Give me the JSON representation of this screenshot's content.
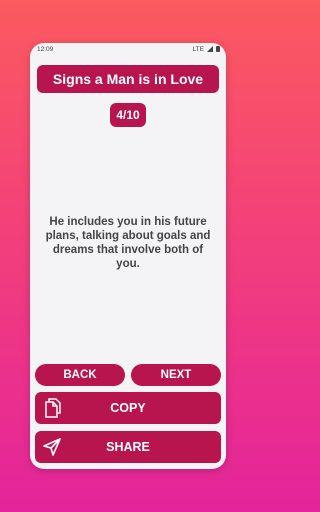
{
  "status_bar": {
    "time": "12:09",
    "network": "LTE"
  },
  "header": {
    "title": "Signs a Man is in Love"
  },
  "counter": "4/10",
  "content": {
    "text": "He includes you in his future plans, talking about goals and dreams that involve both of you."
  },
  "nav": {
    "back_label": "BACK",
    "next_label": "NEXT"
  },
  "actions": {
    "copy_label": "COPY",
    "share_label": "SHARE"
  },
  "colors": {
    "accent": "#b8154f",
    "background": "#f4f4f6",
    "text": "#454545"
  }
}
